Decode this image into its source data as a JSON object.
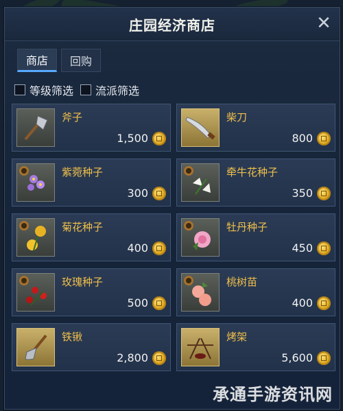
{
  "window": {
    "title": "庄园经济商店",
    "close_glyph": "✕"
  },
  "tabs": [
    {
      "label": "商店",
      "active": true
    },
    {
      "label": "回购",
      "active": false
    }
  ],
  "filters": [
    {
      "label": "等级筛选",
      "checked": false
    },
    {
      "label": "流派筛选",
      "checked": false
    }
  ],
  "items": [
    {
      "name": "斧子",
      "price": "1,500",
      "icon": "axe-icon",
      "icon_bg": "gray"
    },
    {
      "name": "柴刀",
      "price": "800",
      "icon": "machete-icon",
      "icon_bg": "gold"
    },
    {
      "name": "紫菀种子",
      "price": "300",
      "icon": "aster-seed-icon",
      "icon_bg": "gray"
    },
    {
      "name": "牵牛花种子",
      "price": "350",
      "icon": "morning-glory-seed-icon",
      "icon_bg": "gray"
    },
    {
      "name": "菊花种子",
      "price": "400",
      "icon": "chrysanthemum-seed-icon",
      "icon_bg": "gray"
    },
    {
      "name": "牡丹种子",
      "price": "450",
      "icon": "peony-seed-icon",
      "icon_bg": "gray"
    },
    {
      "name": "玫瑰种子",
      "price": "500",
      "icon": "rose-seed-icon",
      "icon_bg": "gray"
    },
    {
      "name": "桃树苗",
      "price": "400",
      "icon": "peach-sapling-icon",
      "icon_bg": "gray"
    },
    {
      "name": "铁锹",
      "price": "2,800",
      "icon": "shovel-icon",
      "icon_bg": "gold"
    },
    {
      "name": "烤架",
      "price": "5,600",
      "icon": "grill-rack-icon",
      "icon_bg": "gold"
    }
  ],
  "currency_icon": "gold-coin-icon",
  "watermark": "承通手游资讯网"
}
